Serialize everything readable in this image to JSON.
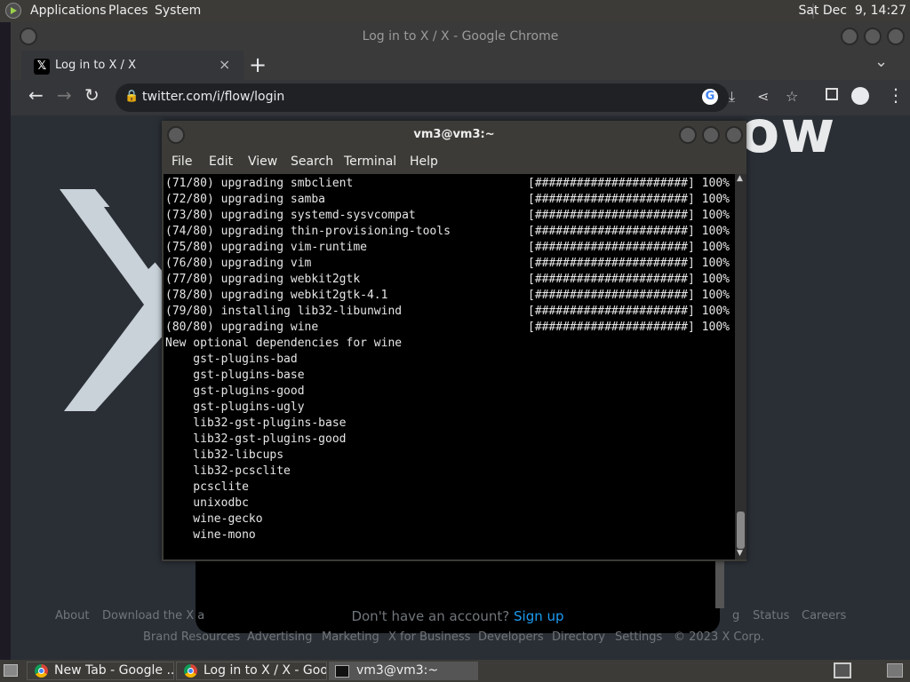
{
  "top_panel": {
    "menus": [
      "Applications",
      "Places",
      "System"
    ],
    "clock": "Sat Dec  9, 14:27"
  },
  "chrome": {
    "window_title": "Log in to X / X - Google Chrome",
    "tab": {
      "title": "Log in to X / X",
      "close": "×"
    },
    "new_tab": "+",
    "tab_menu": "⌄",
    "url": "twitter.com/i/flow/login"
  },
  "page": {
    "headline": "ow",
    "signup_prompt": "Don't have an account?",
    "signup_link": "Sign up",
    "footer_row1": [
      "About",
      "Download the X a",
      "g",
      "Status",
      "Careers"
    ],
    "footer_row2": [
      "Brand Resources",
      "Advertising",
      "Marketing",
      "X for Business",
      "Developers",
      "Directory",
      "Settings",
      "© 2023 X Corp."
    ]
  },
  "terminal": {
    "title": "vm3@vm3:~",
    "menus": [
      "File",
      "Edit",
      "View",
      "Search",
      "Terminal",
      "Help"
    ],
    "lines": [
      "(71/80) upgrading smbclient",
      "(72/80) upgrading samba",
      "(73/80) upgrading systemd-sysvcompat",
      "(74/80) upgrading thin-provisioning-tools",
      "(75/80) upgrading vim-runtime",
      "(76/80) upgrading vim",
      "(77/80) upgrading webkit2gtk",
      "(78/80) upgrading webkit2gtk-4.1",
      "(79/80) installing lib32-libunwind",
      "(80/80) upgrading wine",
      "New optional dependencies for wine",
      "    gst-plugins-bad",
      "    gst-plugins-base",
      "    gst-plugins-good",
      "    gst-plugins-ugly",
      "    lib32-gst-plugins-base",
      "    lib32-gst-plugins-good",
      "    lib32-libcups",
      "    lib32-pcsclite",
      "    pcsclite",
      "    unixodbc",
      "    wine-gecko",
      "    wine-mono"
    ],
    "progress_lines": [
      "[######################] 100%",
      "[######################] 100%",
      "[######################] 100%",
      "[######################] 100%",
      "[######################] 100%",
      "[######################] 100%",
      "[######################] 100%",
      "[######################] 100%",
      "[######################] 100%",
      "[######################] 100%"
    ]
  },
  "taskbar": {
    "tasks": [
      "New Tab - Google ...",
      "Log in to X / X - Goo...",
      "vm3@vm3:~"
    ]
  },
  "colors": {
    "panel": "#3c3b37",
    "chrome_bg": "#202124",
    "page_bg": "#2a2f35",
    "link": "#1d9bf0",
    "terminal_bg": "#000000"
  }
}
